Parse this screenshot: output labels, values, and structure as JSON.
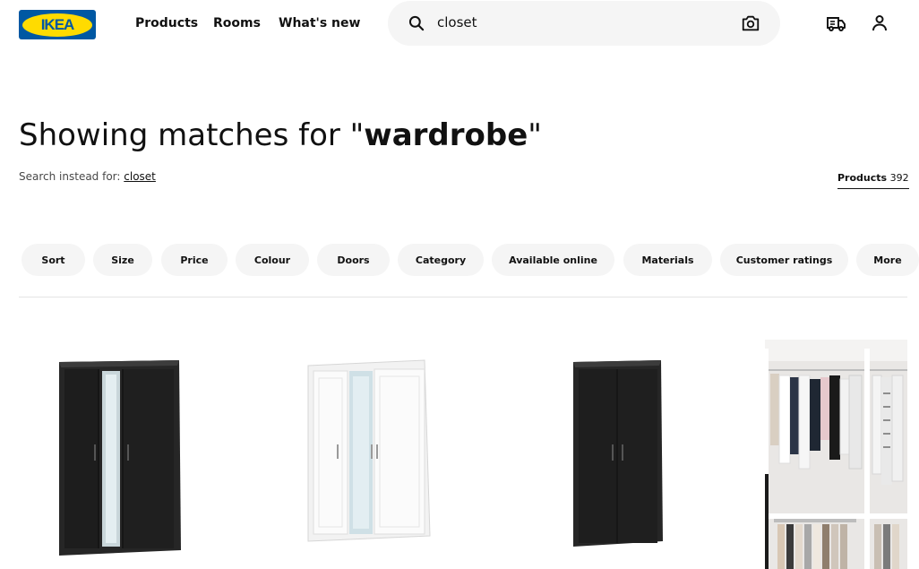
{
  "header": {
    "logo_text": "IKEA",
    "nav": [
      "Products",
      "Rooms",
      "What's new"
    ],
    "search_value": "closet",
    "icons": [
      "search-icon",
      "camera-icon",
      "delivery-truck-icon",
      "user-icon"
    ]
  },
  "results": {
    "heading_prefix": "Showing matches for \"",
    "heading_term": "wardrobe",
    "heading_suffix": "\"",
    "instead_label": "Search instead for: ",
    "instead_link": "closet",
    "count_label": "Products",
    "count_value": "392"
  },
  "filters": [
    "Sort",
    "Size",
    "Price",
    "Colour",
    "Doors",
    "Category",
    "Available online",
    "Materials",
    "Customer ratings",
    "More"
  ],
  "colors": {
    "brand_blue": "#0058a3",
    "brand_yellow": "#ffdb00",
    "chip_bg": "#f5f5f5"
  }
}
